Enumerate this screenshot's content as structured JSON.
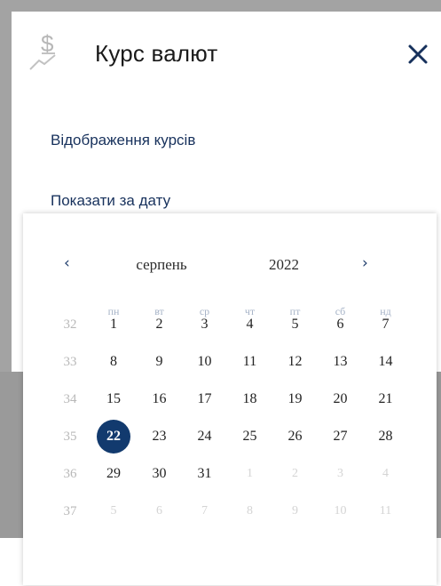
{
  "header": {
    "title": "Курс валют"
  },
  "links": {
    "rates_display": "Відображення курсів",
    "show_for_date": "Показати за дату"
  },
  "icons": {
    "title_icon": "dollar-growth-icon",
    "close": "close-icon",
    "prev": "chevron-left-icon",
    "next": "chevron-right-icon"
  },
  "calendar": {
    "prev_glyph": "‹",
    "next_glyph": "›",
    "month": "серпень",
    "year": "2022",
    "weekdays": [
      "пн",
      "вт",
      "ср",
      "чт",
      "пт",
      "сб",
      "нд"
    ],
    "weeks": [
      {
        "week": "32",
        "days": [
          {
            "d": "1",
            "cur": true
          },
          {
            "d": "2",
            "cur": true
          },
          {
            "d": "3",
            "cur": true
          },
          {
            "d": "4",
            "cur": true
          },
          {
            "d": "5",
            "cur": true
          },
          {
            "d": "6",
            "cur": true
          },
          {
            "d": "7",
            "cur": true
          }
        ]
      },
      {
        "week": "33",
        "days": [
          {
            "d": "8",
            "cur": true
          },
          {
            "d": "9",
            "cur": true
          },
          {
            "d": "10",
            "cur": true
          },
          {
            "d": "11",
            "cur": true
          },
          {
            "d": "12",
            "cur": true
          },
          {
            "d": "13",
            "cur": true
          },
          {
            "d": "14",
            "cur": true
          }
        ]
      },
      {
        "week": "34",
        "days": [
          {
            "d": "15",
            "cur": true
          },
          {
            "d": "16",
            "cur": true
          },
          {
            "d": "17",
            "cur": true
          },
          {
            "d": "18",
            "cur": true
          },
          {
            "d": "19",
            "cur": true
          },
          {
            "d": "20",
            "cur": true
          },
          {
            "d": "21",
            "cur": true
          }
        ]
      },
      {
        "week": "35",
        "days": [
          {
            "d": "22",
            "cur": true,
            "selected": true
          },
          {
            "d": "23",
            "cur": true
          },
          {
            "d": "24",
            "cur": true
          },
          {
            "d": "25",
            "cur": true
          },
          {
            "d": "26",
            "cur": true
          },
          {
            "d": "27",
            "cur": true
          },
          {
            "d": "28",
            "cur": true
          }
        ]
      },
      {
        "week": "36",
        "days": [
          {
            "d": "29",
            "cur": true
          },
          {
            "d": "30",
            "cur": true
          },
          {
            "d": "31",
            "cur": true
          },
          {
            "d": "1",
            "cur": false
          },
          {
            "d": "2",
            "cur": false
          },
          {
            "d": "3",
            "cur": false
          },
          {
            "d": "4",
            "cur": false
          }
        ]
      },
      {
        "week": "37",
        "days": [
          {
            "d": "5",
            "cur": false
          },
          {
            "d": "6",
            "cur": false
          },
          {
            "d": "7",
            "cur": false
          },
          {
            "d": "8",
            "cur": false
          },
          {
            "d": "9",
            "cur": false
          },
          {
            "d": "10",
            "cur": false
          },
          {
            "d": "11",
            "cur": false
          }
        ]
      }
    ]
  },
  "colors": {
    "accent": "#123a6e",
    "link": "#17315c",
    "overlay_gray": "#9a9a9a"
  }
}
